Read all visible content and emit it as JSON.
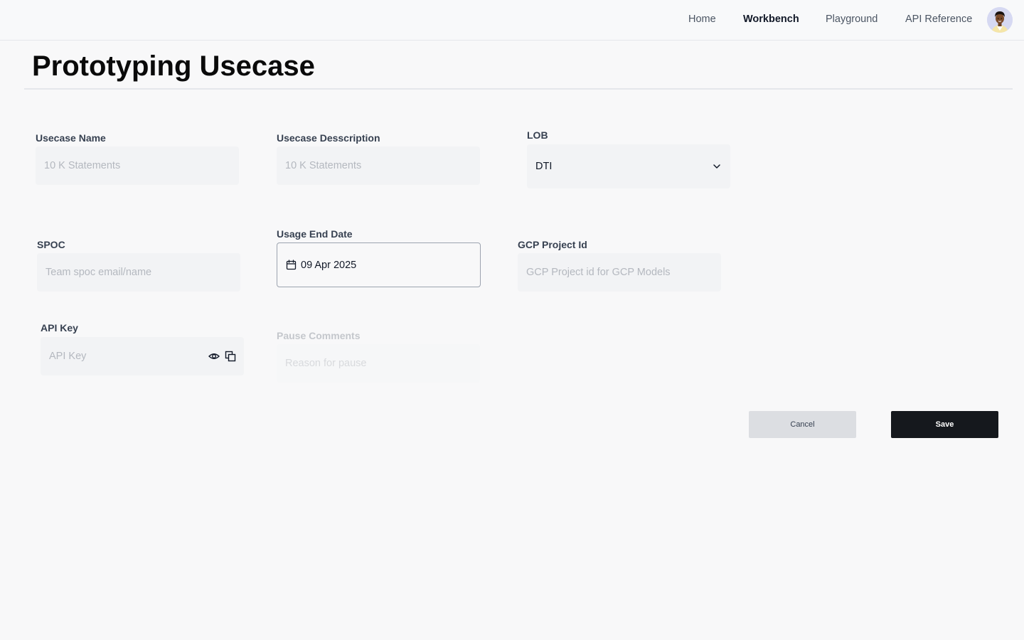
{
  "nav": {
    "items": [
      {
        "label": "Home",
        "active": false
      },
      {
        "label": "Workbench",
        "active": true
      },
      {
        "label": "Playground",
        "active": false
      },
      {
        "label": "API Reference",
        "active": false
      }
    ]
  },
  "page": {
    "title": "Prototyping Usecase"
  },
  "form": {
    "usecase_name": {
      "label": "Usecase Name",
      "placeholder": "10 K Statements",
      "value": ""
    },
    "usecase_description": {
      "label": "Usecase Desscription",
      "placeholder": "10 K Statements",
      "value": ""
    },
    "lob": {
      "label": "LOB",
      "selected": "DTI"
    },
    "spoc": {
      "label": "SPOC",
      "placeholder": "Team spoc email/name",
      "value": ""
    },
    "usage_end_date": {
      "label": "Usage End Date",
      "value": "09 Apr 2025"
    },
    "gcp_project_id": {
      "label": "GCP Project Id",
      "placeholder": "GCP Project id for GCP Models",
      "value": ""
    },
    "api_key": {
      "label": "API Key",
      "placeholder": "API Key",
      "value": ""
    },
    "pause_comments": {
      "label": "Pause Comments",
      "placeholder": "Reason for pause",
      "value": ""
    }
  },
  "actions": {
    "cancel_label": "Cancel",
    "save_label": "Save"
  },
  "colors": {
    "primary_button": "#15181d",
    "secondary_button": "#dcdee2",
    "input_bg": "#f2f3f5",
    "page_bg": "#f8f8f9"
  }
}
